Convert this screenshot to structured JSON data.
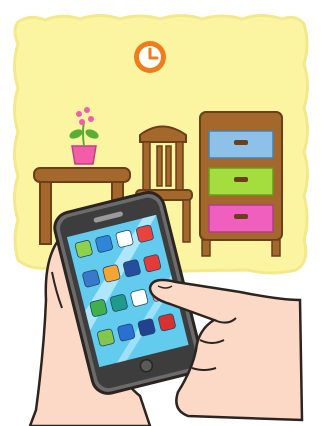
{
  "scene": {
    "colors": {
      "wall": "#fbf5a2",
      "wall_edge": "#f3e98a",
      "clock_face": "#f07d1b",
      "wood": "#a4682d",
      "wood_dark": "#6b3f1a",
      "drawer_blue": "#8ec1ea",
      "drawer_green": "#a4dd3e",
      "drawer_pink": "#ef5fbd",
      "pot_pink": "#f25da8",
      "flower_pink": "#ef5fb0",
      "leaf_green": "#5aae37",
      "skin": "#fcd9c6",
      "skin_line": "#2b2420",
      "phone_body": "#6b6b6b",
      "phone_frame": "#3d3d3d",
      "screen": "#63cbee",
      "screen_shine": "#c7efff",
      "outline": "#2b2420"
    },
    "icons": [
      {
        "name": "app-icon-green",
        "color": "#8ed14b"
      },
      {
        "name": "app-icon-blue",
        "color": "#2f86d8"
      },
      {
        "name": "app-icon-white",
        "color": "#ffffff"
      },
      {
        "name": "app-icon-red",
        "color": "#e8433c"
      },
      {
        "name": "app-icon-blue-2",
        "color": "#3a78c9"
      },
      {
        "name": "app-icon-orange",
        "color": "#f6a531"
      },
      {
        "name": "app-icon-navy",
        "color": "#254e9e"
      },
      {
        "name": "app-icon-red-2",
        "color": "#e43a3a"
      },
      {
        "name": "app-icon-green-2",
        "color": "#3fb04a"
      },
      {
        "name": "app-icon-teal",
        "color": "#1f9b8c"
      },
      {
        "name": "app-icon-white-2",
        "color": "#ffffff"
      },
      {
        "name": "app-icon-pink",
        "color": "#f5a4c0"
      },
      {
        "name": "app-icon-lime",
        "color": "#86c54b"
      },
      {
        "name": "app-icon-blue-3",
        "color": "#2b6fd0"
      },
      {
        "name": "app-icon-darkblue",
        "color": "#22418f"
      },
      {
        "name": "app-icon-red-3",
        "color": "#d7322f"
      }
    ]
  }
}
